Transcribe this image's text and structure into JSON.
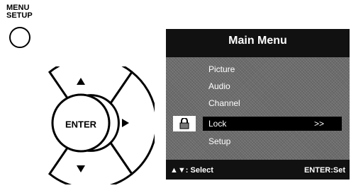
{
  "remote": {
    "menu_label_line1": "MENU",
    "menu_label_line2": "SETUP",
    "enter_label": "ENTER",
    "icons": [
      "up-arrow-icon",
      "down-arrow-icon",
      "right-arrow-icon"
    ]
  },
  "osd": {
    "title": "Main Menu",
    "items": [
      {
        "label": "Picture"
      },
      {
        "label": "Audio"
      },
      {
        "label": "Channel"
      },
      {
        "label": "Lock",
        "selected": true,
        "arrow": ">>"
      },
      {
        "label": "Setup"
      }
    ],
    "footer": {
      "left": "▲▼: Select",
      "right": "ENTER:Set"
    },
    "colors": {
      "panel": "#6c6c6c",
      "header": "#111111",
      "selected": "#000000",
      "text": "#ffffff"
    }
  }
}
